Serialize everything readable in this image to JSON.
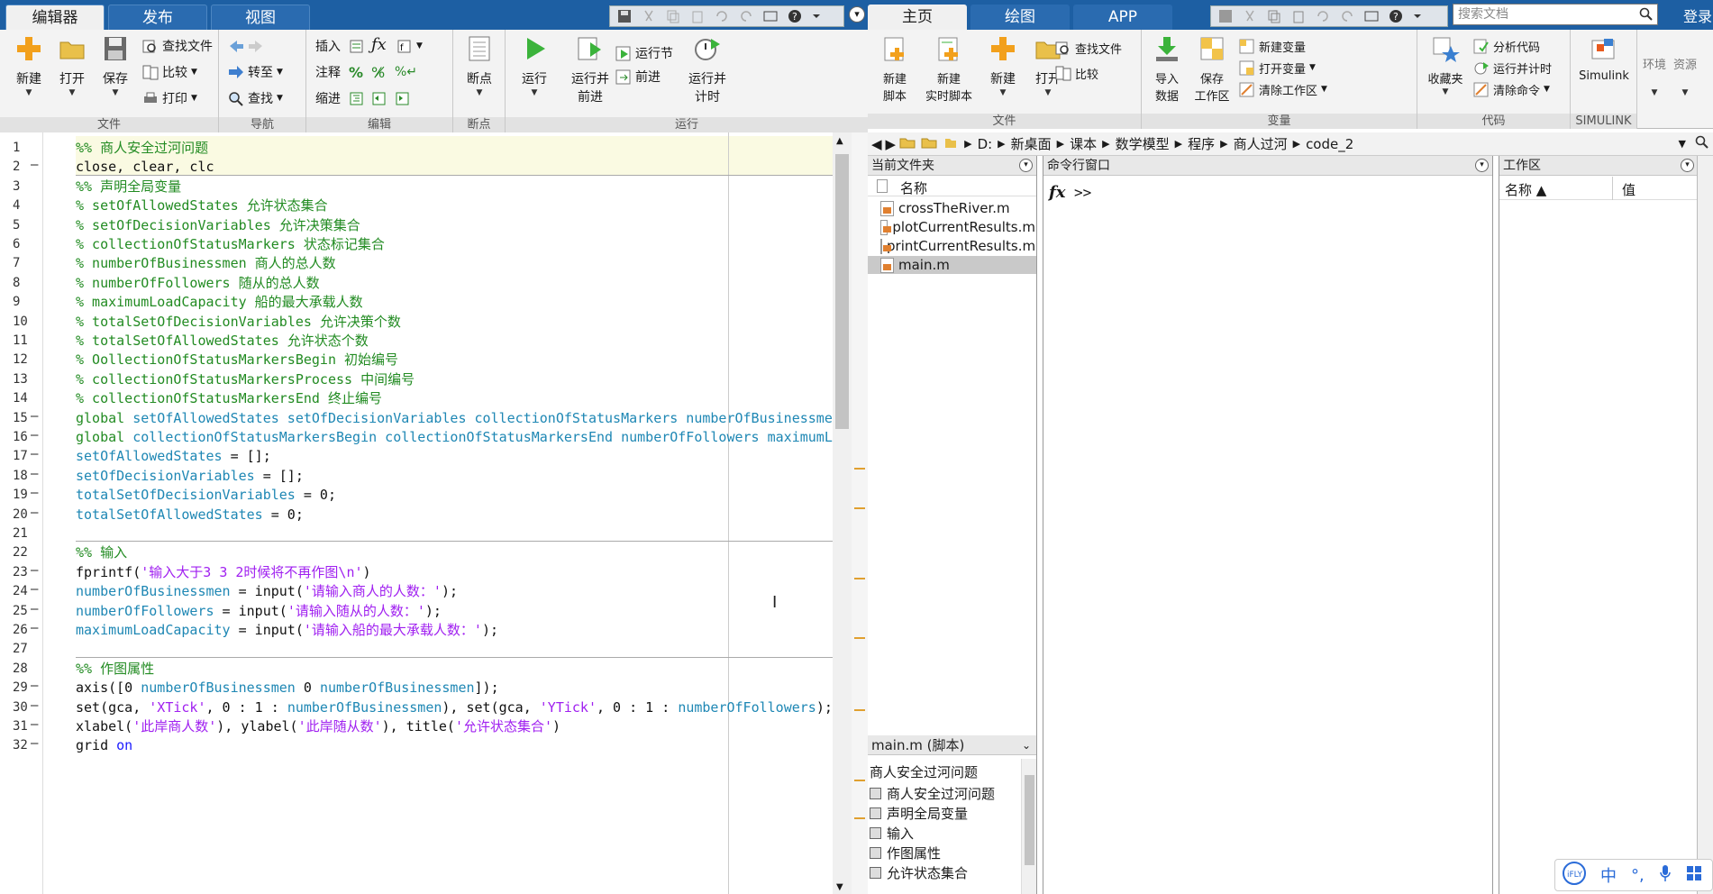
{
  "editor": {
    "tabs": [
      "编辑器",
      "发布",
      "视图"
    ],
    "active_tab": 0,
    "groups": {
      "file": {
        "label": "文件",
        "new": "新建",
        "open": "打开",
        "save": "保存",
        "find_files": "查找文件",
        "compare": "比较",
        "print": "打印"
      },
      "navigate": {
        "label": "导航",
        "goto": "转至",
        "find": "查找"
      },
      "edit": {
        "label": "编辑",
        "insert": "插入",
        "comment": "注释",
        "indent": "缩进"
      },
      "breakpoints": {
        "label": "断点",
        "breakpoints": "断点"
      },
      "run": {
        "label": "运行",
        "run": "运行",
        "run_advance_1": "运行并",
        "run_advance_2": "前进",
        "run_section": "运行节",
        "advance": "前进",
        "run_time_1": "运行并",
        "run_time_2": "计时"
      }
    },
    "lines": [
      {
        "n": "1",
        "dash": false
      },
      {
        "n": "2",
        "dash": true
      },
      {
        "n": "3",
        "dash": false
      },
      {
        "n": "4",
        "dash": false
      },
      {
        "n": "5",
        "dash": false
      },
      {
        "n": "6",
        "dash": false
      },
      {
        "n": "7",
        "dash": false
      },
      {
        "n": "8",
        "dash": false
      },
      {
        "n": "9",
        "dash": false
      },
      {
        "n": "10",
        "dash": false
      },
      {
        "n": "11",
        "dash": false
      },
      {
        "n": "12",
        "dash": false
      },
      {
        "n": "13",
        "dash": false
      },
      {
        "n": "14",
        "dash": false
      },
      {
        "n": "15",
        "dash": true
      },
      {
        "n": "16",
        "dash": true
      },
      {
        "n": "17",
        "dash": true
      },
      {
        "n": "18",
        "dash": true
      },
      {
        "n": "19",
        "dash": true
      },
      {
        "n": "20",
        "dash": true
      },
      {
        "n": "21",
        "dash": false
      },
      {
        "n": "22",
        "dash": false
      },
      {
        "n": "23",
        "dash": true
      },
      {
        "n": "24",
        "dash": true
      },
      {
        "n": "25",
        "dash": true
      },
      {
        "n": "26",
        "dash": true
      },
      {
        "n": "27",
        "dash": false
      },
      {
        "n": "28",
        "dash": false
      },
      {
        "n": "29",
        "dash": true
      },
      {
        "n": "30",
        "dash": true
      },
      {
        "n": "31",
        "dash": true
      },
      {
        "n": "32",
        "dash": true
      }
    ],
    "code": [
      [
        [
          "%% 商人安全过河问题",
          "cm"
        ]
      ],
      [
        [
          "close, clear, clc",
          "pl"
        ]
      ],
      [
        [
          "%% 声明全局变量",
          "cm"
        ]
      ],
      [
        [
          "% setOfAllowedStates 允许状态集合",
          "cm"
        ]
      ],
      [
        [
          "% setOfDecisionVariables 允许决策集合",
          "cm"
        ]
      ],
      [
        [
          "% collectionOfStatusMarkers 状态标记集合",
          "cm"
        ]
      ],
      [
        [
          "% numberOfBusinessmen 商人的总人数",
          "cm"
        ]
      ],
      [
        [
          "% numberOfFollowers 随从的总人数",
          "cm"
        ]
      ],
      [
        [
          "% maximumLoadCapacity 船的最大承载人数",
          "cm"
        ]
      ],
      [
        [
          "% totalSetOfDecisionVariables 允许决策个数",
          "cm"
        ]
      ],
      [
        [
          "% totalSetOfAllowedStates 允许状态个数",
          "cm"
        ]
      ],
      [
        [
          "% OollectionOfStatusMarkersBegin 初始编号",
          "cm"
        ]
      ],
      [
        [
          "% collectionOfStatusMarkersProcess 中间编号",
          "cm"
        ]
      ],
      [
        [
          "% collectionOfStatusMarkersEnd 终止编号",
          "cm"
        ]
      ],
      [
        [
          "global ",
          "cm"
        ],
        [
          "setOfAllowedStates setOfDecisionVariables collectionOfStatusMarkers numberOfBusinessmen",
          "var"
        ]
      ],
      [
        [
          "global ",
          "cm"
        ],
        [
          "collectionOfStatusMarkersBegin collectionOfStatusMarkersEnd numberOfFollowers maximumLoadCapacity",
          "var"
        ]
      ],
      [
        [
          "setOfAllowedStates",
          "var"
        ],
        [
          " = [];",
          "pl"
        ]
      ],
      [
        [
          "setOfDecisionVariables",
          "var"
        ],
        [
          " = [];",
          "pl"
        ]
      ],
      [
        [
          "totalSetOfDecisionVariables",
          "var"
        ],
        [
          " = 0;",
          "pl"
        ]
      ],
      [
        [
          "totalSetOfAllowedStates",
          "var"
        ],
        [
          " = 0;",
          "pl"
        ]
      ],
      [
        [
          "",
          "pl"
        ]
      ],
      [
        [
          "%% 输入",
          "cm"
        ]
      ],
      [
        [
          "fprintf(",
          "pl"
        ],
        [
          "'输入大于3 3 2时候将不再作图\\n'",
          "str"
        ],
        [
          ")",
          "pl"
        ]
      ],
      [
        [
          "numberOfBusinessmen",
          "var"
        ],
        [
          " = input(",
          "pl"
        ],
        [
          "'请输入商人的人数：'",
          "str"
        ],
        [
          ");",
          "pl"
        ]
      ],
      [
        [
          "numberOfFollowers",
          "var"
        ],
        [
          " = input(",
          "pl"
        ],
        [
          "'请输入随从的人数：'",
          "str"
        ],
        [
          ");",
          "pl"
        ]
      ],
      [
        [
          "maximumLoadCapacity",
          "var"
        ],
        [
          " = input(",
          "pl"
        ],
        [
          "'请输入船的最大承载人数：'",
          "str"
        ],
        [
          ");",
          "pl"
        ]
      ],
      [
        [
          "",
          "pl"
        ]
      ],
      [
        [
          "%% 作图属性",
          "cm"
        ]
      ],
      [
        [
          "axis([0 ",
          "pl"
        ],
        [
          "numberOfBusinessmen",
          "var"
        ],
        [
          " 0 ",
          "pl"
        ],
        [
          "numberOfBusinessmen",
          "var"
        ],
        [
          "]);",
          "pl"
        ]
      ],
      [
        [
          "set(gca, ",
          "pl"
        ],
        [
          "'XTick'",
          "str"
        ],
        [
          ", 0 : 1 : ",
          "pl"
        ],
        [
          "numberOfBusinessmen",
          "var"
        ],
        [
          "), set(gca, ",
          "pl"
        ],
        [
          "'YTick'",
          "str"
        ],
        [
          ", 0 : 1 : ",
          "pl"
        ],
        [
          "numberOfFollowers",
          "var"
        ],
        [
          ");",
          "pl"
        ]
      ],
      [
        [
          "xlabel(",
          "pl"
        ],
        [
          "'此岸商人数'",
          "str"
        ],
        [
          "), ylabel(",
          "pl"
        ],
        [
          "'此岸随从数'",
          "str"
        ],
        [
          "), title(",
          "pl"
        ],
        [
          "'允许状态集合'",
          "str"
        ],
        [
          ")",
          "pl"
        ]
      ],
      [
        [
          "grid ",
          "pl"
        ],
        [
          "on",
          "kw"
        ]
      ]
    ]
  },
  "main": {
    "tabs": [
      "主页",
      "绘图",
      "APP"
    ],
    "active_tab": 0,
    "search_placeholder": "搜索文档",
    "login": "登录",
    "groups": {
      "file": {
        "label": "文件",
        "new_script_1": "新建",
        "new_script_2": "脚本",
        "new_live_1": "新建",
        "new_live_2": "实时脚本",
        "new": "新建",
        "open": "打开",
        "find_files": "查找文件",
        "compare": "比较"
      },
      "variable": {
        "label": "变量",
        "import_1": "导入",
        "import_2": "数据",
        "save_ws_1": "保存",
        "save_ws_2": "工作区",
        "new_var": "新建变量",
        "open_var": "打开变量",
        "clear_ws": "清除工作区"
      },
      "code": {
        "label": "代码",
        "favorites": "收藏夹",
        "analyze": "分析代码",
        "run_time": "运行并计时",
        "clear_cmd": "清除命令"
      },
      "simulink": {
        "label": "SIMULINK",
        "simulink": "Simulink"
      },
      "env": "环境",
      "res": "资源"
    },
    "path": [
      "D:",
      "新桌面",
      "课本",
      "数学模型",
      "程序",
      "商人过河",
      "code_2"
    ],
    "current_folder": {
      "title": "当前文件夹",
      "name_col": "名称",
      "files": [
        "crossTheRiver.m",
        "plotCurrentResults.m",
        "printCurrentResults.m",
        "main.m"
      ],
      "selected": 3
    },
    "details": {
      "title": "main.m  (脚本)",
      "heading": "商人安全过河问题",
      "sections": [
        "商人安全过河问题",
        "声明全局变量",
        "输入",
        "作图属性",
        "允许状态集合"
      ]
    },
    "command_window": {
      "title": "命令行窗口",
      "fx": "fx",
      "prompt": ">>"
    },
    "workspace": {
      "title": "工作区",
      "name_col": "名称 ▲",
      "value_col": "值"
    }
  },
  "ime": {
    "lang": "中"
  }
}
